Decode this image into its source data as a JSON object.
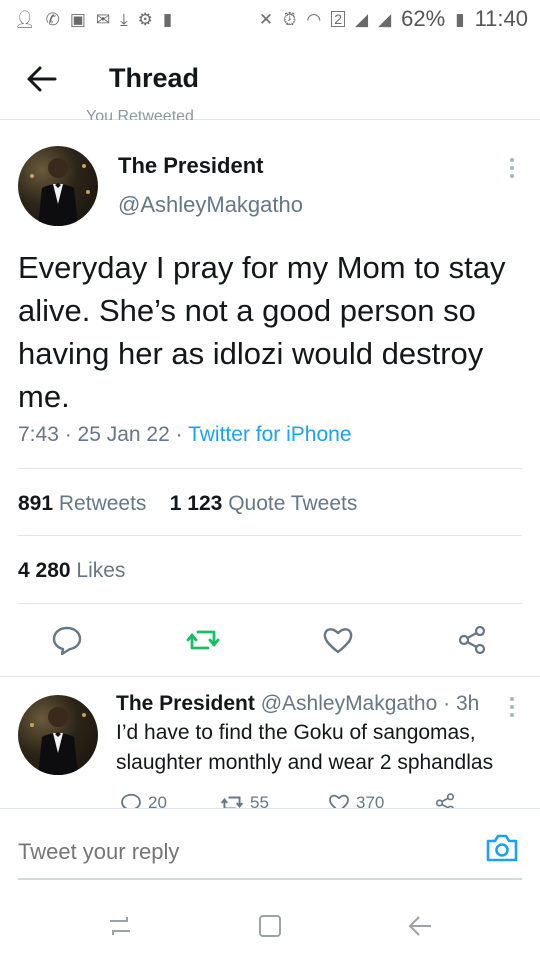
{
  "status_bar": {
    "battery": "62%",
    "time": "11:40",
    "sim_slot": "2"
  },
  "header": {
    "title": "Thread"
  },
  "retweet_context": "You Retweeted",
  "tweet": {
    "name": "The President",
    "handle": "@AshleyMakgatho",
    "text": "Everyday I pray for my Mom to stay alive. She’s not a good person so having her as idlozi would destroy me.",
    "time": "7:43",
    "date": "25 Jan 22",
    "source": "Twitter for iPhone",
    "retweets": "891",
    "retweets_label": "Retweets",
    "quotes": "1 123",
    "quotes_label": "Quote Tweets",
    "likes": "4 280",
    "likes_label": "Likes"
  },
  "reply": {
    "name": "The President",
    "handle": "@AshleyMakgatho",
    "age": "3h",
    "text": "I’d have to find the Goku of sangomas, slaughter monthly and wear 2 sphandlas",
    "reply_count": "20",
    "retweet_count": "55",
    "like_count": "370"
  },
  "compose": {
    "placeholder": "Tweet your reply"
  },
  "colors": {
    "accent": "#1da1f2",
    "retweet_green": "#17bf63",
    "muted": "#657786"
  }
}
